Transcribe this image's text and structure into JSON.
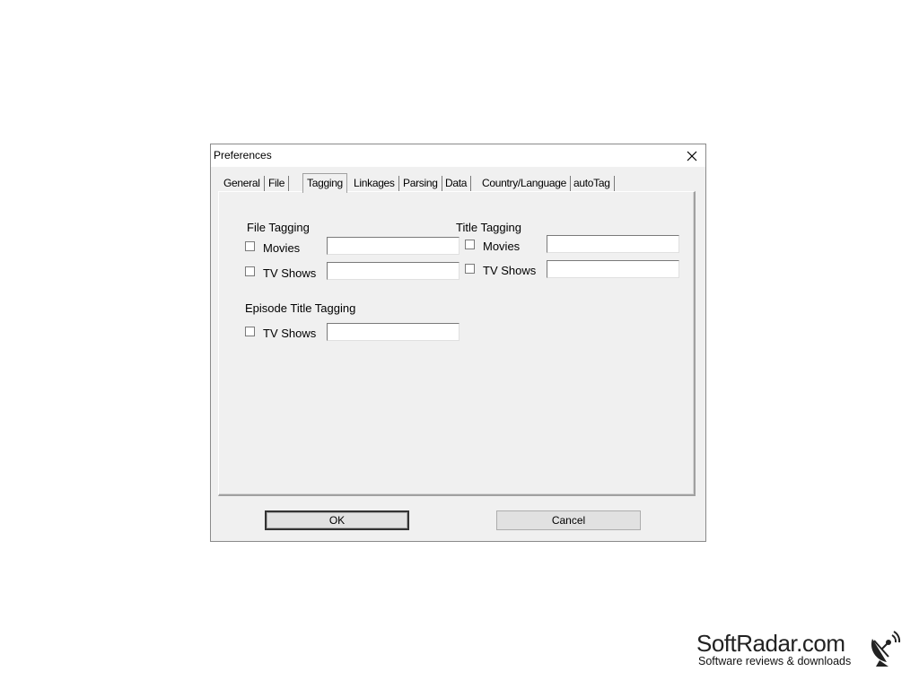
{
  "window": {
    "title": "Preferences",
    "close_icon": "close-icon"
  },
  "tabs": [
    {
      "label": "General",
      "active": false
    },
    {
      "label": "File",
      "active": false
    },
    {
      "label": "Tagging",
      "active": true
    },
    {
      "label": "Linkages",
      "active": false
    },
    {
      "label": "Parsing",
      "active": false
    },
    {
      "label": "Data",
      "active": false
    },
    {
      "label": "Country/Language",
      "active": false
    },
    {
      "label": "autoTag",
      "active": false
    }
  ],
  "file_tagging": {
    "label": "File Tagging",
    "movies": {
      "label": "Movies",
      "checked": false,
      "value": ""
    },
    "tv_shows": {
      "label": "TV Shows",
      "checked": false,
      "value": ""
    }
  },
  "title_tagging": {
    "label": "Title Tagging",
    "movies": {
      "label": "Movies",
      "checked": false,
      "value": ""
    },
    "tv_shows": {
      "label": "TV Shows",
      "checked": false,
      "value": ""
    }
  },
  "episode_title_tagging": {
    "label": "Episode Title Tagging",
    "tv_shows": {
      "label": "TV Shows",
      "checked": false,
      "value": ""
    }
  },
  "buttons": {
    "ok": "OK",
    "cancel": "Cancel"
  },
  "watermark": {
    "name": "SoftRadar.com",
    "tagline": "Software reviews & downloads",
    "icon": "satellite-dish-icon"
  }
}
